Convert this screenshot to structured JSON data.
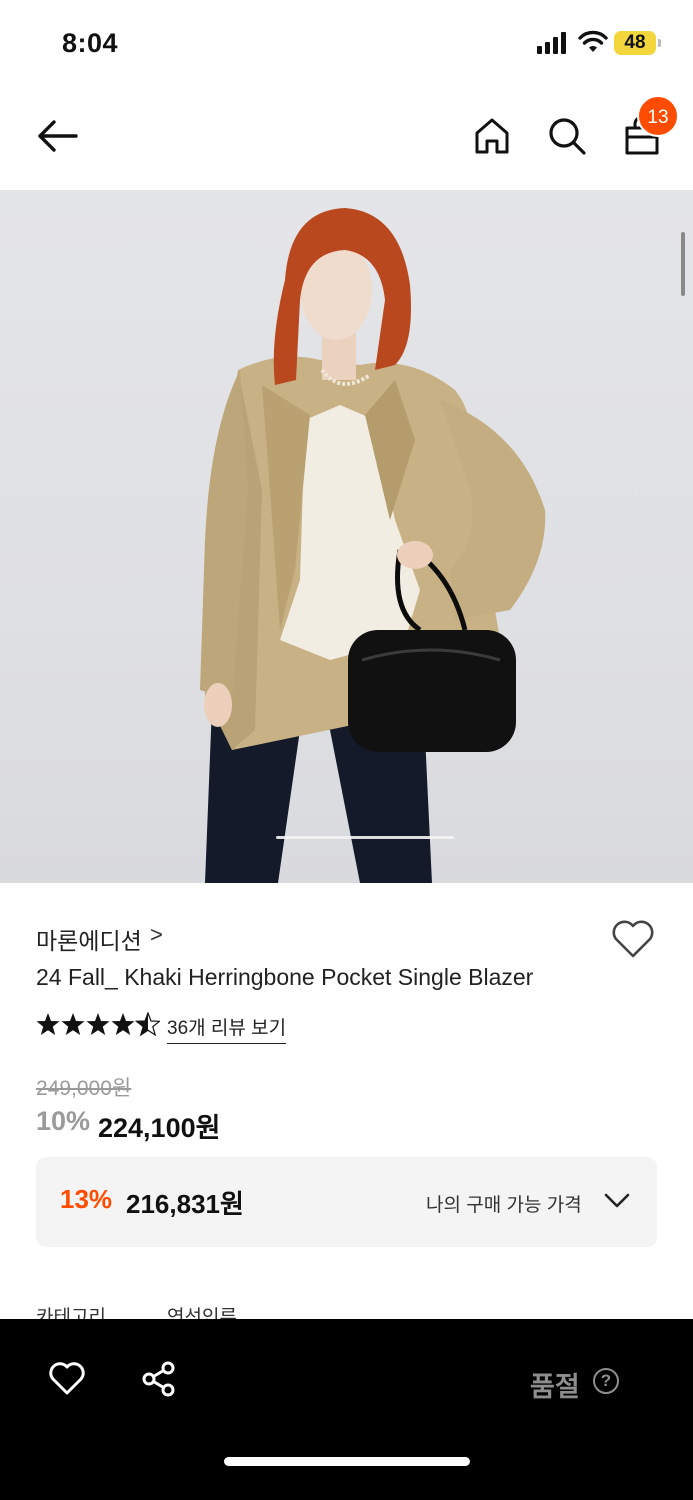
{
  "status_bar": {
    "time": "8:04",
    "battery": "48"
  },
  "header": {
    "icons": [
      "back-arrow-icon",
      "home-icon",
      "search-icon",
      "shopping-bag-icon"
    ],
    "cart_count": "13"
  },
  "product": {
    "image_page_indicator": "1",
    "brand": "마론에디션",
    "brand_chevron": ">",
    "name": "24 Fall_ Khaki Herringbone Pocket Single Blazer",
    "rating": 4.5,
    "review_link": "36개 리뷰 보기",
    "original_price": "249,000원",
    "discount_rate": "10%",
    "sale_price": "224,100원"
  },
  "my_price_box": {
    "discount_rate": "13%",
    "price": "216,831원",
    "label": "나의 구매 가능 가격"
  },
  "tabs_partial": [
    "카테고리",
    "연선인류"
  ],
  "bottom_bar": {
    "status_label": "품절",
    "help_glyph": "?"
  },
  "colors": {
    "accent": "#ff4c00",
    "bottom_bar": "#000000",
    "battery": "#f2d63b"
  }
}
